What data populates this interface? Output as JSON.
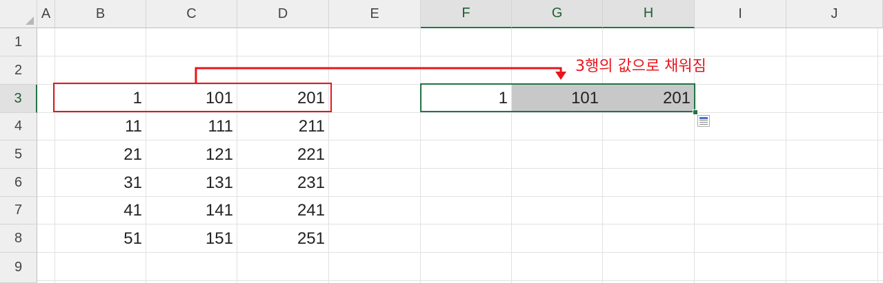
{
  "columns": [
    "A",
    "B",
    "C",
    "D",
    "E",
    "F",
    "G",
    "H",
    "I",
    "J"
  ],
  "rows": [
    "1",
    "2",
    "3",
    "4",
    "5",
    "6",
    "7",
    "8",
    "9"
  ],
  "source_values": [
    [
      "1",
      "101",
      "201"
    ],
    [
      "11",
      "111",
      "211"
    ],
    [
      "21",
      "121",
      "221"
    ],
    [
      "31",
      "131",
      "231"
    ],
    [
      "41",
      "141",
      "241"
    ],
    [
      "51",
      "151",
      "251"
    ]
  ],
  "filled_values": [
    "1",
    "101",
    "201"
  ],
  "annotation": "3행의 값으로 채워짐",
  "colors": {
    "highlight_red": "#e8151b",
    "selection_green": "#217346",
    "fill_gray": "#c8c8c8"
  },
  "icons": {
    "corner": "select-all-triangle",
    "options": "paste-options-icon"
  }
}
